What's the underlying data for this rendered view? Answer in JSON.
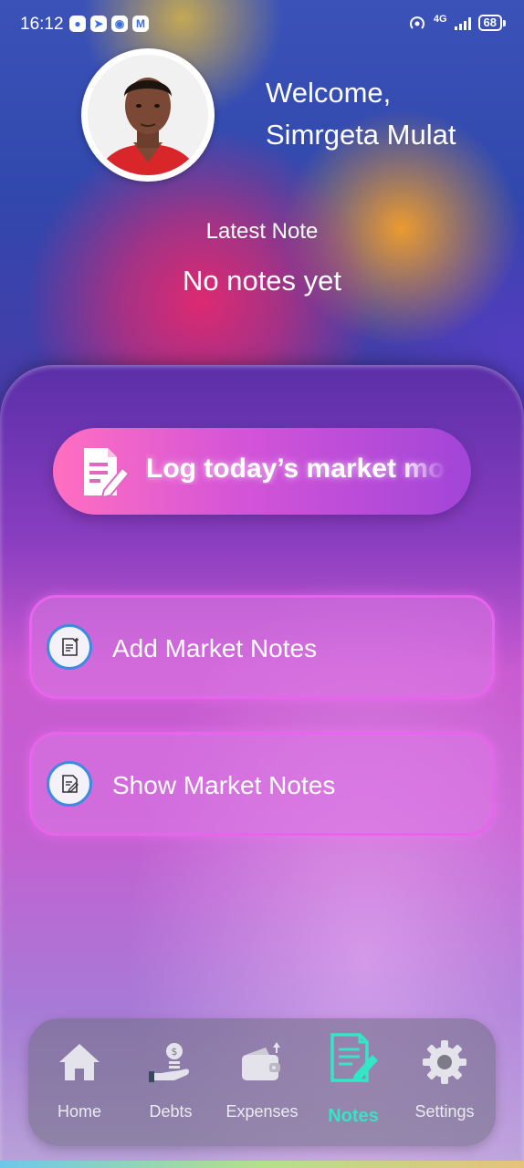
{
  "status_bar": {
    "time": "16:12",
    "network": "4G",
    "battery": "68",
    "apps": [
      {
        "icon": "chat-icon",
        "glyph": "●"
      },
      {
        "icon": "telegram-icon",
        "glyph": "➤"
      },
      {
        "icon": "chrome-icon",
        "glyph": "◉"
      },
      {
        "icon": "mail-icon",
        "glyph": "M"
      }
    ]
  },
  "header": {
    "welcome": "Welcome,",
    "user_name": "Simrgeta Mulat",
    "avatar_icon": "profile-photo"
  },
  "latest_note": {
    "label": "Latest Note",
    "value": "No notes yet"
  },
  "hero": {
    "text": "Log today’s market moves",
    "icon": "note-edit-icon"
  },
  "actions": [
    {
      "label": "Add Market Notes",
      "icon": "note-add-icon"
    },
    {
      "label": "Show Market Notes",
      "icon": "note-view-icon"
    }
  ],
  "bottom_nav": {
    "items": [
      {
        "label": "Home",
        "icon": "home-icon",
        "active": false
      },
      {
        "label": "Debts",
        "icon": "money-hand-icon",
        "active": false
      },
      {
        "label": "Expenses",
        "icon": "wallet-icon",
        "active": false
      },
      {
        "label": "Notes",
        "icon": "notes-icon",
        "active": true
      },
      {
        "label": "Settings",
        "icon": "gear-icon",
        "active": false
      }
    ]
  },
  "colors": {
    "active_nav": "#32e6c6",
    "card_border": "#e765ec",
    "icon_ring": "#3b8be0"
  }
}
